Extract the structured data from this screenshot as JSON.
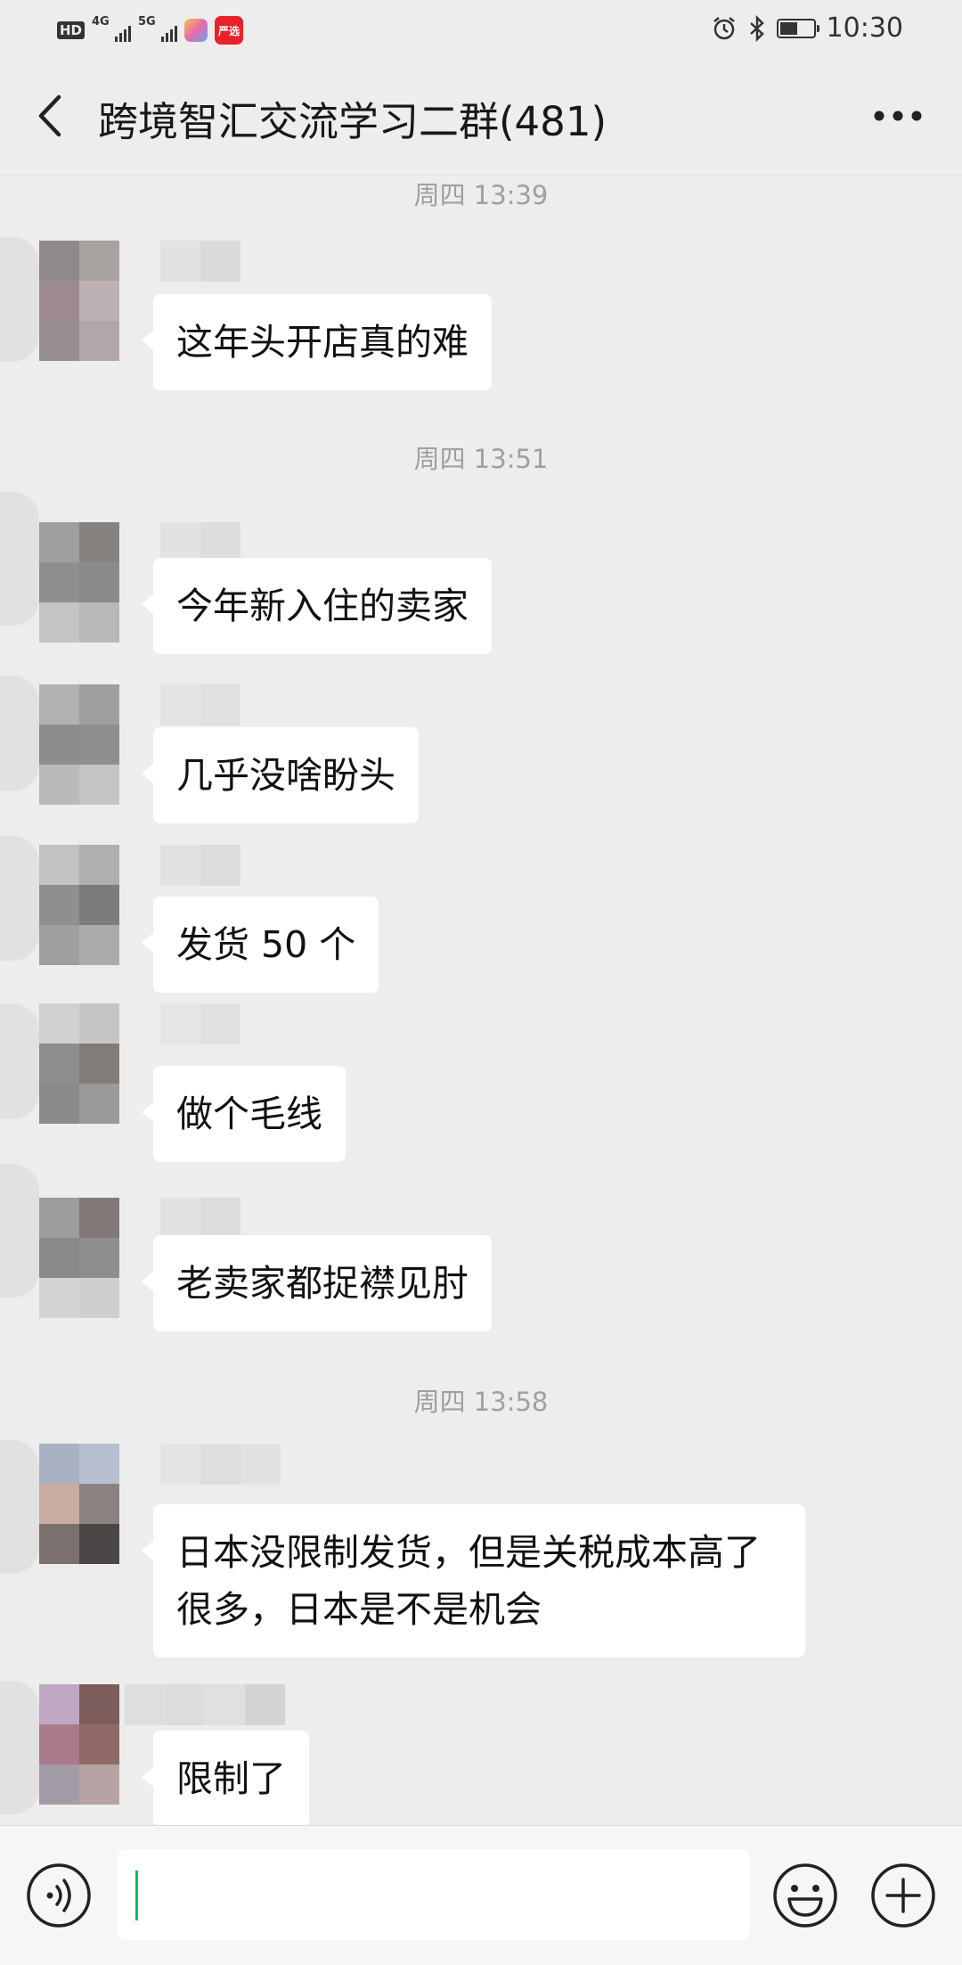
{
  "status_bar": {
    "hd_label": "HD",
    "network_1": "4G",
    "network_2": "5G",
    "app_badge": "严选",
    "time": "10:30",
    "battery_level": 0.55
  },
  "header": {
    "title": "跨境智汇交流学习二群(481)"
  },
  "timestamps": {
    "t1": "周四 13:39",
    "t2": "周四 13:51",
    "t3": "周四 13:58"
  },
  "messages": [
    {
      "text": "这年头开店真的难"
    },
    {
      "text": "今年新入住的卖家"
    },
    {
      "text": "几乎没啥盼头"
    },
    {
      "text": "发货 50 个"
    },
    {
      "text": "做个毛线"
    },
    {
      "text": "老卖家都捉襟见肘"
    },
    {
      "text": "日本没限制发货，但是关税成本高了很多，日本是不是机会"
    },
    {
      "text": "限制了"
    }
  ],
  "input": {
    "placeholder": ""
  },
  "icons": {
    "back": "chevron-left-icon",
    "more": "more-dots-icon",
    "voice": "voice-icon",
    "emoji": "emoji-icon",
    "plus": "plus-icon"
  },
  "colors": {
    "background": "#ededed",
    "bubble": "#ffffff",
    "cursor": "#07c160",
    "timestamp": "#a0a0a0"
  }
}
